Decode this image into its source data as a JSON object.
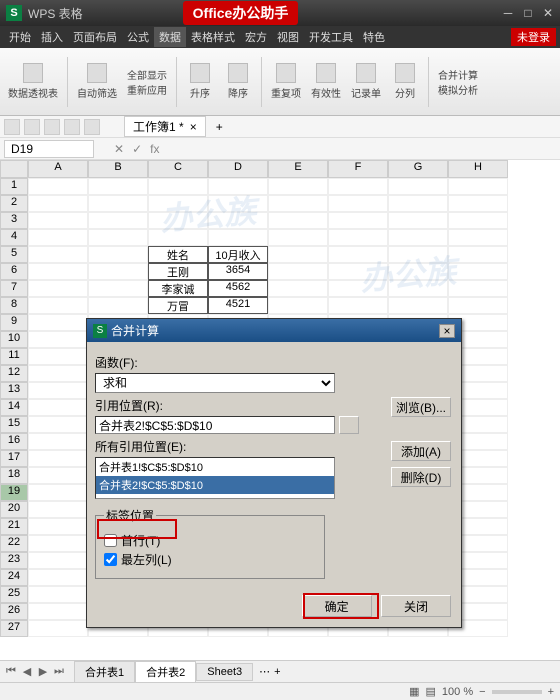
{
  "titlebar": {
    "app": "WPS 表格",
    "banner": "Office办公助手"
  },
  "menubar": {
    "items": [
      "开始",
      "插入",
      "页面布局",
      "公式",
      "数据",
      "表格样式",
      "宏方",
      "视图",
      "开发工具",
      "特色"
    ],
    "active_index": 4,
    "login_badge": "未登录"
  },
  "ribbon": {
    "buttons": [
      "数据透视表",
      "自动筛选",
      "全部显示",
      "重新应用",
      "升序",
      "降序",
      "重复项",
      "有效性",
      "记录单",
      "分列",
      "合并计算",
      "模拟分析"
    ]
  },
  "workbook_tab": {
    "name": "工作簿1 *"
  },
  "namebox": {
    "cell_ref": "D19"
  },
  "columns": [
    "A",
    "B",
    "C",
    "D",
    "E",
    "F",
    "G",
    "H"
  ],
  "table": {
    "header": [
      "姓名",
      "10月收入"
    ],
    "rows": [
      [
        "王刚",
        "3654"
      ],
      [
        "李家诚",
        "4562"
      ],
      [
        "万冒",
        "4521"
      ]
    ]
  },
  "selected_row": 19,
  "dialog": {
    "title": "合并计算",
    "function_label": "函数(F):",
    "function_value": "求和",
    "ref_label": "引用位置(R):",
    "ref_value": "合并表2!$C$5:$D$10",
    "browse_btn": "浏览(B)...",
    "allrefs_label": "所有引用位置(E):",
    "allrefs": [
      "合并表1!$C$5:$D$10",
      "合并表2!$C$5:$D$10"
    ],
    "add_btn": "添加(A)",
    "delete_btn": "删除(D)",
    "labelpos_legend": "标签位置",
    "firstrow_label": "首行(T)",
    "firstrow_checked": false,
    "leftcol_label": "最左列(L)",
    "leftcol_checked": true,
    "ok_btn": "确定",
    "close_btn": "关闭"
  },
  "sheets": {
    "tabs": [
      "合并表1",
      "合并表2",
      "Sheet3"
    ],
    "active_index": 1
  },
  "statusbar": {
    "zoom": "100 %"
  }
}
